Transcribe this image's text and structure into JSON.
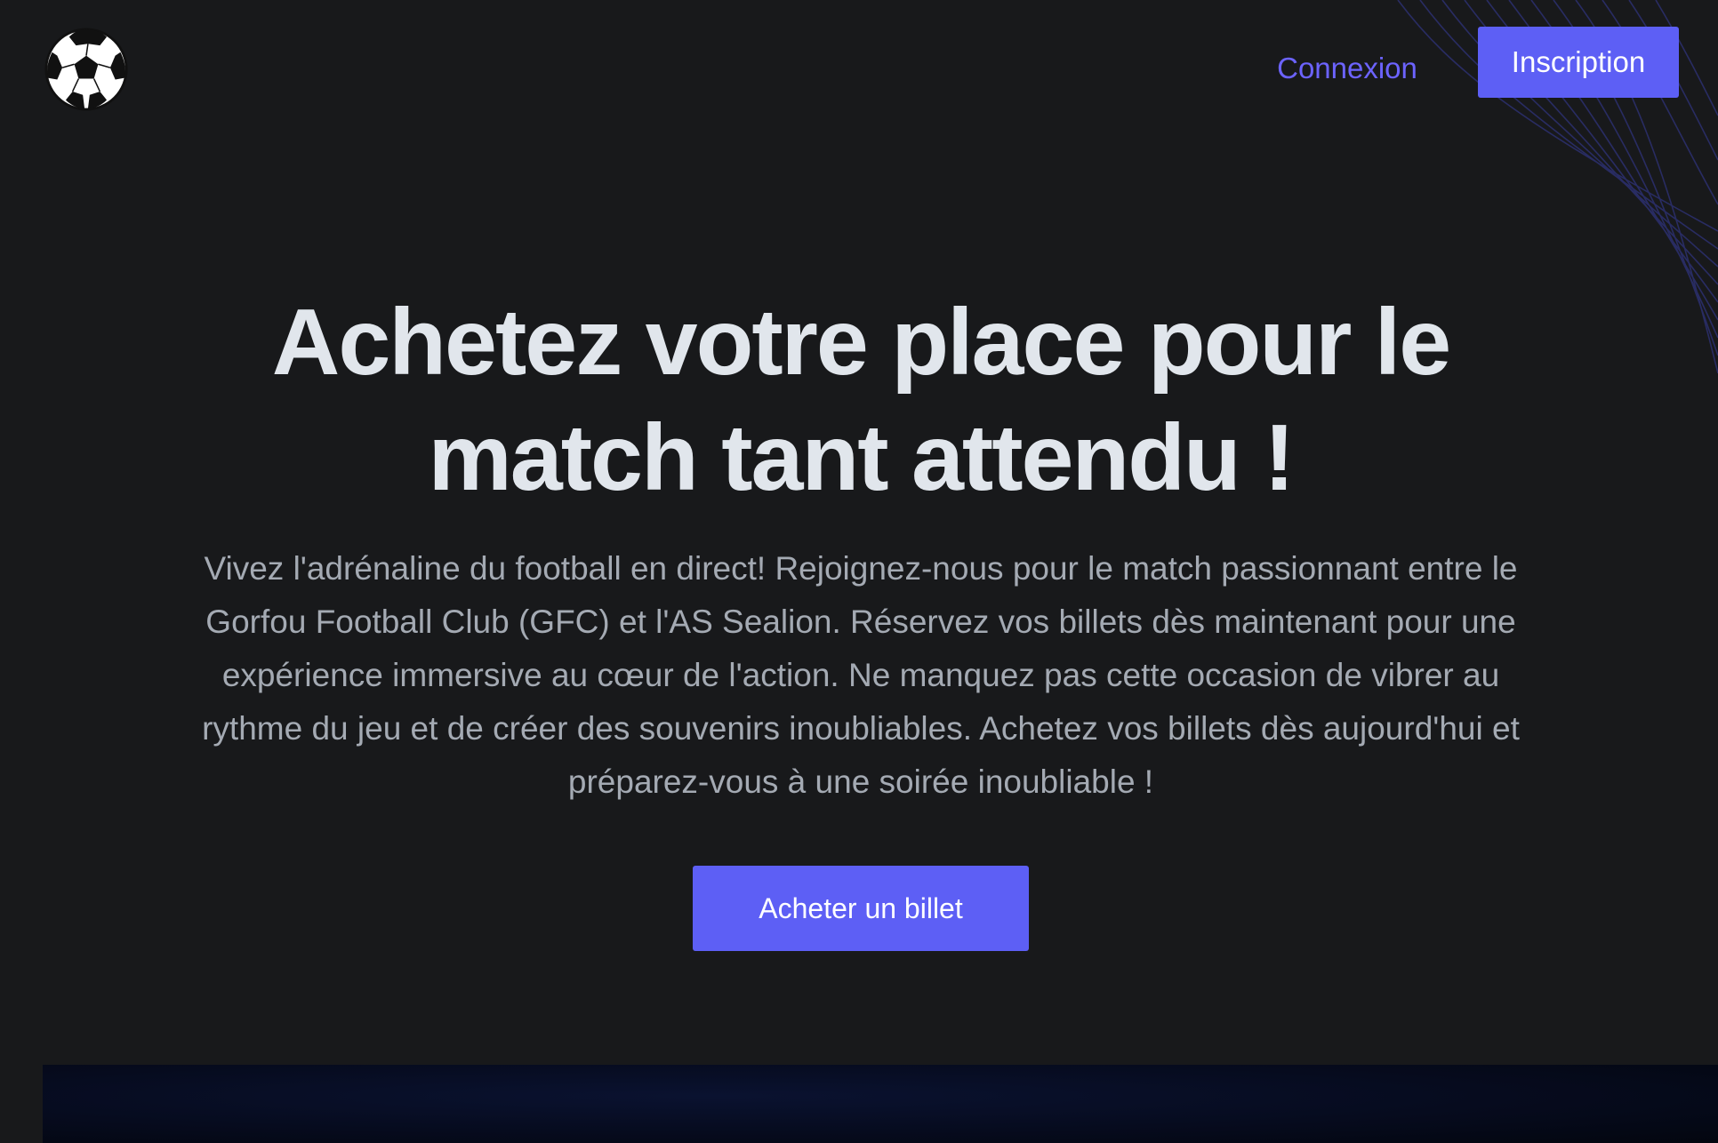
{
  "header": {
    "logo_icon": "soccer-ball-icon",
    "login_label": "Connexion",
    "signup_label": "Inscription"
  },
  "hero": {
    "title": "Achetez votre place pour le match tant attendu !",
    "description": "Vivez l'adrénaline du football en direct! Rejoignez-nous pour le match passionnant entre le Gorfou Football Club (GFC) et l'AS Sealion. Réservez vos billets dès maintenant pour une expérience immersive au cœur de l'action. Ne manquez pas cette occasion de vibrer au rythme du jeu et de créer des souvenirs inoubliables. Achetez vos billets dès aujourd'hui et préparez-vous à une soirée inoubliable !",
    "cta_label": "Acheter un billet"
  },
  "colors": {
    "background": "#18191b",
    "accent": "#5d5ff5",
    "link": "#6c63ff",
    "title": "#e1e6ec",
    "body_text": "#a4aab3"
  }
}
